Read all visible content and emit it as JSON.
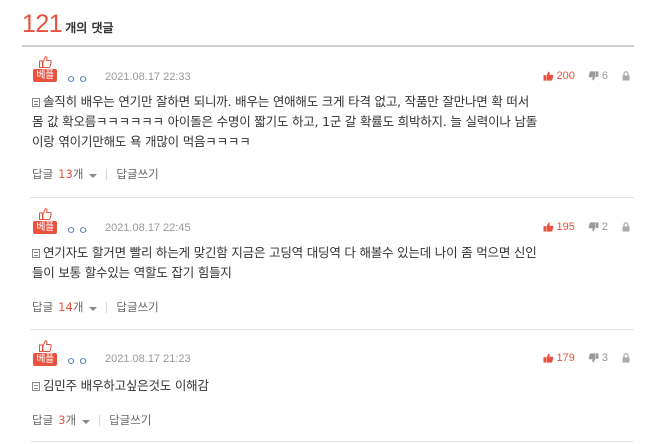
{
  "header": {
    "comment_count": "121",
    "comment_count_label": "개의 댓글"
  },
  "colors": {
    "accent": "#e8523e",
    "nickname": "#4a6fb5",
    "muted": "#999999"
  },
  "comments": [
    {
      "badge": "베플",
      "nickname": "ㅇㅇ",
      "date": "2021.08.17 22:33",
      "upvotes": "200",
      "downvotes": "6",
      "body_line1": "솔직히 배우는 연기만 잘하면 되니까. 배우는 연애해도 크게 타격 없고, 작품만 잘만나면 확 떠서",
      "body_line2": "몸 값 확오름ㅋㅋㅋㅋㅋㅋ 아이돌은 수명이 짧기도 하고, 1군 갈 확률도 희박하지. 늘 실력이나 남돌",
      "body_line3": "이랑 엮이기만해도 욕 개많이 먹음ㅋㅋㅋㅋ",
      "reply_label": "답글",
      "reply_count": "13",
      "reply_unit": "개",
      "write_label": "답글쓰기"
    },
    {
      "badge": "베플",
      "nickname": "ㅇㅇ",
      "date": "2021.08.17 22:45",
      "upvotes": "195",
      "downvotes": "2",
      "body_line1": "연기자도 할거면 빨리 하는게 맞긴함 지금은 고딩역 대딩역 다 해볼수 있는데 나이 좀 먹으면 신인",
      "body_line2": "들이 보통 할수있는 역할도 잡기 힘들지",
      "reply_label": "답글",
      "reply_count": "14",
      "reply_unit": "개",
      "write_label": "답글쓰기"
    },
    {
      "badge": "베플",
      "nickname": "ㅇㅇ",
      "date": "2021.08.17 21:23",
      "upvotes": "179",
      "downvotes": "3",
      "body_line1": "김민주 배우하고싶은것도 이해감",
      "reply_label": "답글",
      "reply_count": "3",
      "reply_unit": "개",
      "write_label": "답글쓰기"
    }
  ],
  "icons": [
    "thumbs-up-icon",
    "thumbs-down-icon",
    "lock-icon",
    "document-icon",
    "caret-down-icon"
  ]
}
